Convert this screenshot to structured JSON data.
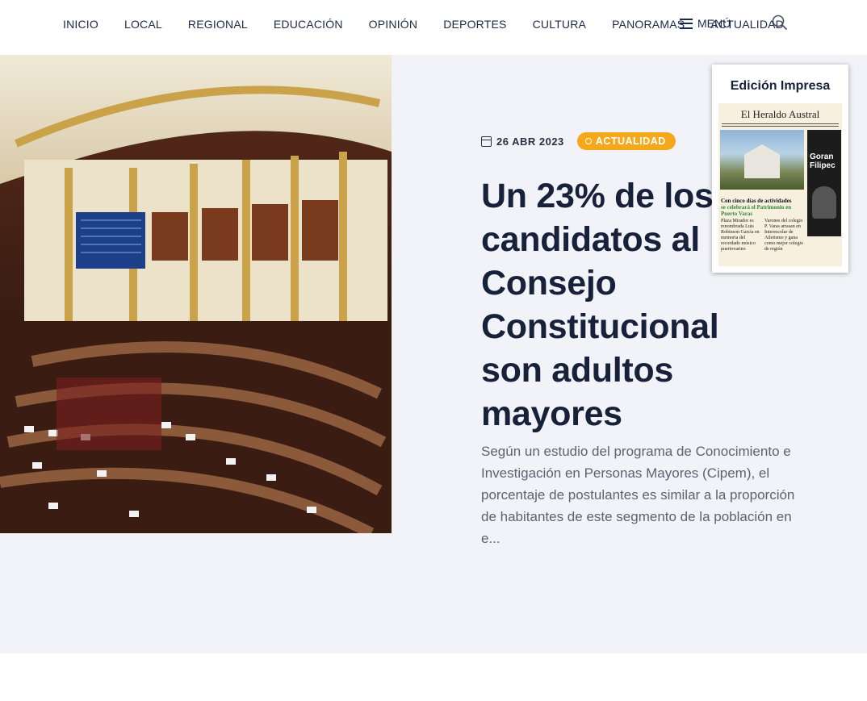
{
  "nav": {
    "items": [
      "INICIO",
      "LOCAL",
      "REGIONAL",
      "EDUCACIÓN",
      "OPINIÓN",
      "DEPORTES",
      "CULTURA",
      "PANORAMAS",
      "ACTUALIDAD"
    ],
    "menu_label": "MENÚ"
  },
  "hero": {
    "date": "26 ABR 2023",
    "category": "ACTUALIDAD",
    "headline": "Un 23% de los candidatos al Consejo Constitucional son adultos mayores",
    "excerpt": "Según un estudio del programa de Conocimiento e Investigación en Personas Mayores (Cipem), el porcentaje de postulantes es similar a la proporción de habitantes de este segmento de la población en e..."
  },
  "edition": {
    "title": "Edición Impresa",
    "masthead": "El Heraldo Austral",
    "side_name": "Goran Filipec",
    "headline_a": "Con cinco días de actividades",
    "headline_b": "se celebrará el Patrimonio en Puerto Varas",
    "col1": "Plaza Mirador es renombrada Luis Robinson García en memoria del recordado músico puertovarino",
    "col2": "Varones del colegio P. Varas arrasan en Interescolar de Atletismo y gana como mejor colegio de región"
  },
  "colors": {
    "accent": "#f6a81b",
    "headline": "#17213a",
    "hero_bg": "#f2f3f8"
  },
  "icons": {
    "search": "search-icon",
    "menu": "hamburger-icon",
    "calendar": "calendar-icon"
  }
}
